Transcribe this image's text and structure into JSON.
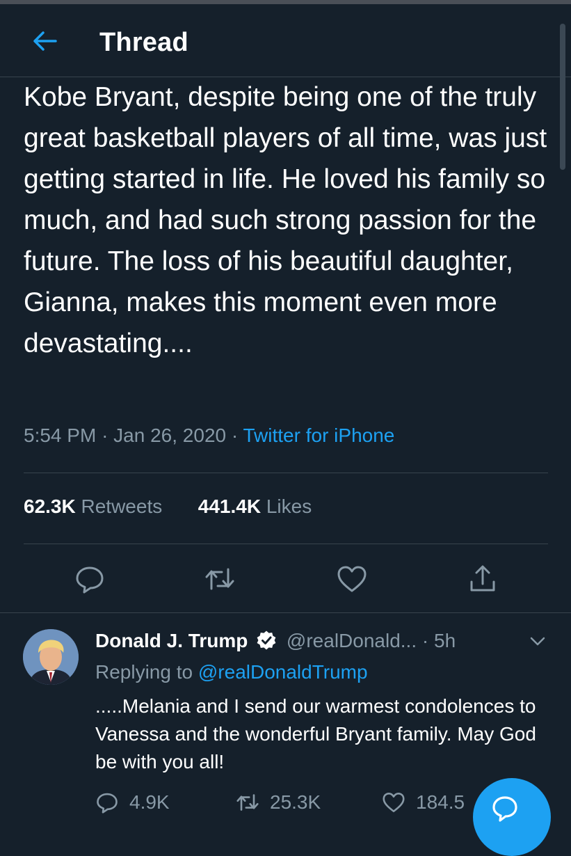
{
  "header": {
    "title": "Thread"
  },
  "tweet": {
    "text": "Kobe Bryant, despite being one of the truly great basketball players of all time, was just getting started in life. He loved his family so much, and had such strong passion for the future. The loss of his beautiful daughter, Gianna, makes this moment even more devastating....",
    "time": "5:54 PM",
    "date": "Jan 26, 2020",
    "source": "Twitter for iPhone",
    "retweets_count": "62.3K",
    "retweets_label": "Retweets",
    "likes_count": "441.4K",
    "likes_label": "Likes"
  },
  "reply": {
    "name": "Donald J. Trump",
    "handle": "@realDonald...",
    "time": "5h",
    "replying_prefix": "Replying to",
    "replying_to": "@realDonaldTrump",
    "text": ".....Melania and I send our warmest condolences to Vanessa and the wonderful Bryant family. May God be with you all!",
    "reply_count": "4.9K",
    "retweet_count": "25.3K",
    "like_count": "184.5"
  },
  "icons": {
    "back": "arrow-left-icon",
    "reply": "comment-icon",
    "retweet": "retweet-icon",
    "like": "heart-icon",
    "share": "share-icon",
    "verified": "verified-badge-icon",
    "more": "chevron-down-icon",
    "compose": "compose-reply-icon"
  },
  "colors": {
    "background": "#15202b",
    "accent": "#1da1f2",
    "secondary_text": "#8899a6",
    "divider": "#38444d"
  }
}
